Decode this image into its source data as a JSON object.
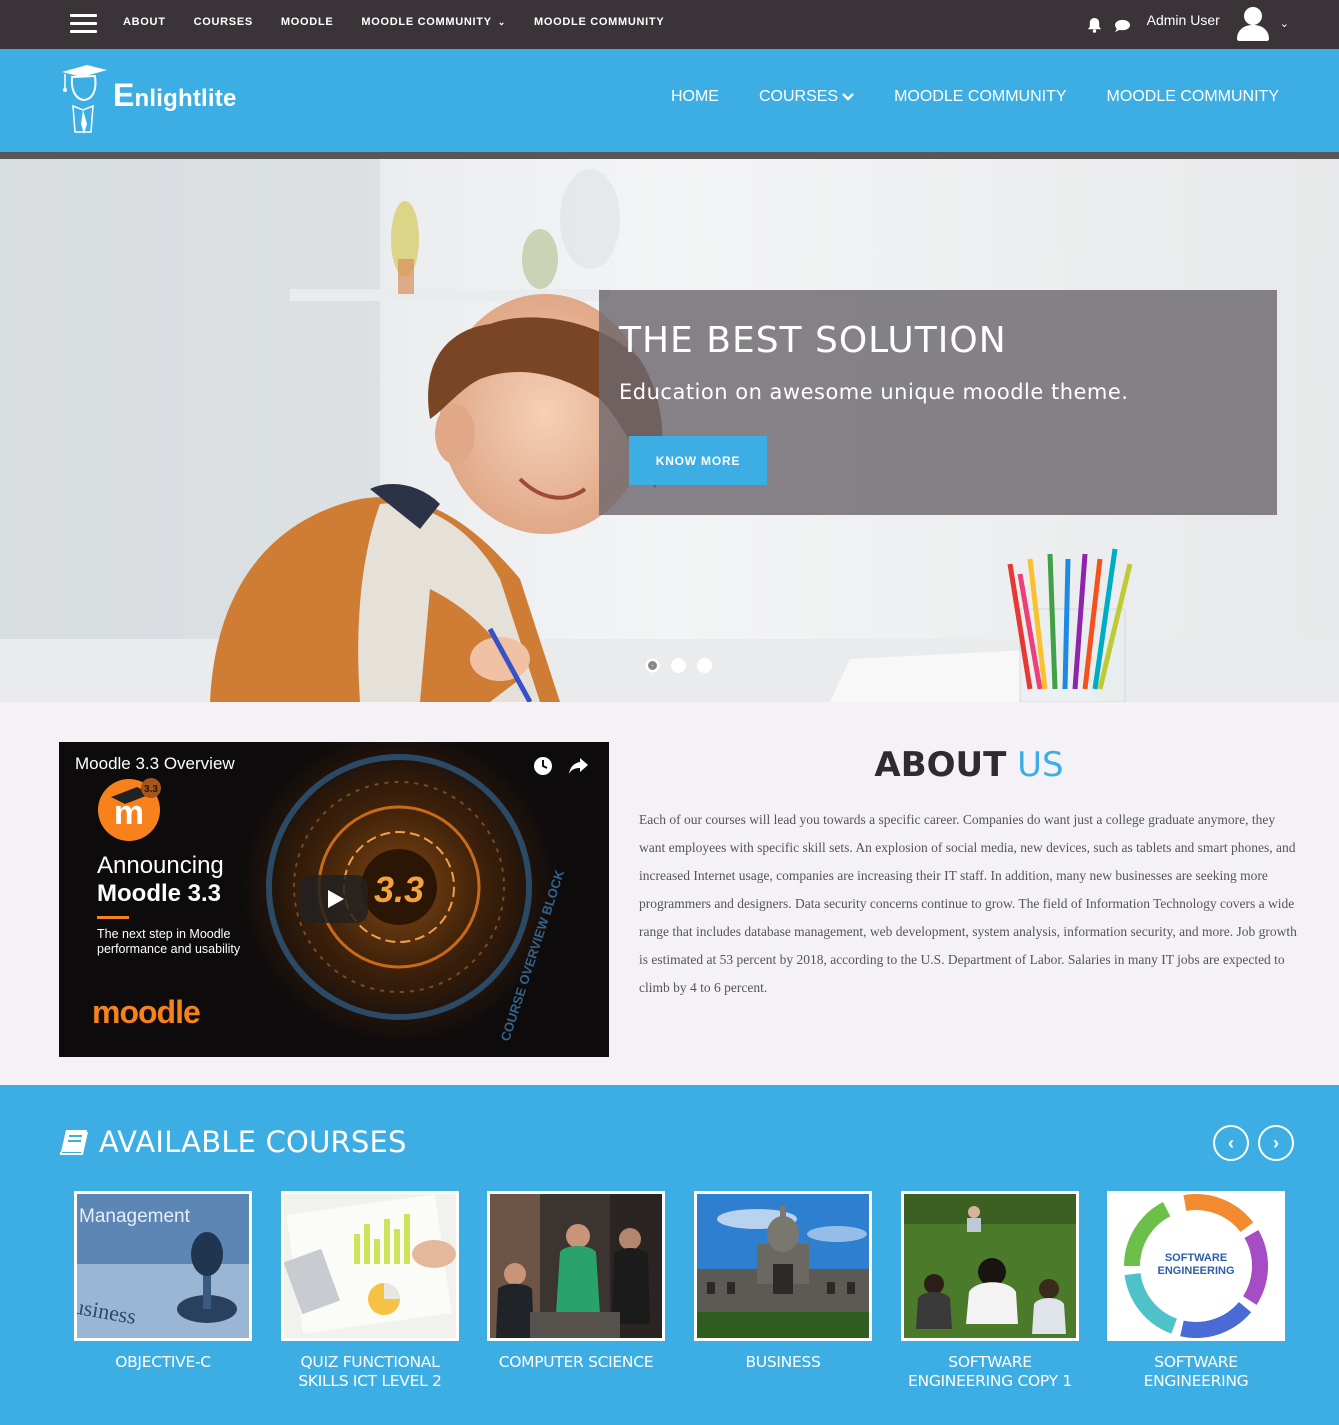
{
  "topbar": {
    "nav": [
      "ABOUT",
      "COURSES",
      "MOODLE",
      "MOODLE COMMUNITY",
      "MOODLE COMMUNITY"
    ],
    "user_name": "Admin User"
  },
  "header": {
    "logo_initial": "E",
    "logo_rest": "nlightlite",
    "nav": {
      "home": "HOME",
      "courses": "COURSES",
      "community1": "MOODLE COMMUNITY",
      "community2": "MOODLE COMMUNITY"
    }
  },
  "hero": {
    "title": "THE BEST SOLUTION",
    "subtitle": "Education on awesome unique moodle theme.",
    "button": "KNOW MORE",
    "slides": 3,
    "active_slide": 1
  },
  "video": {
    "title": "Moodle 3.3 Overview",
    "announce_line1": "Announcing",
    "announce_line2": "Moodle 3.3",
    "announce_line3": "The next step in Moodle performance and usability",
    "badge": "3.3",
    "brand": "moodle",
    "dial_text": "3.3",
    "ring_text": "COURSE OVERVIEW BLOCK"
  },
  "about": {
    "title_bold": "ABOUT",
    "title_accent": "US",
    "text": "Each of our courses will lead you towards a specific career. Companies do want just a college graduate anymore, they want employees with specific skill sets. An explosion of social media, new devices, such as tablets and smart phones, and increased Internet usage, companies are increasing their IT staff. In addition, many new businesses are seeking more programmers and designers. Data security concerns continue to grow. The field of Information Technology covers a wide range that includes database management, web development, system analysis, information security, and more. Job growth is estimated at 53 percent by 2018, according to the U.S. Department of Labor. Salaries in many IT jobs are expected to climb by 4 to 6 percent."
  },
  "courses": {
    "title": "AVAILABLE COURSES",
    "items": [
      {
        "name": "OBJECTIVE-C",
        "thumb_text": "Management"
      },
      {
        "name": "QUIZ FUNCTIONAL SKILLS ICT LEVEL 2"
      },
      {
        "name": "COMPUTER SCIENCE"
      },
      {
        "name": "BUSINESS"
      },
      {
        "name": "SOFTWARE ENGINEERING COPY 1"
      },
      {
        "name": "SOFTWARE ENGINEERING",
        "thumb_text": "SOFTWARE ENGINEERING"
      }
    ]
  },
  "colors": {
    "accent": "#3daee3",
    "topbar": "#3a3439",
    "moodle_orange": "#f7821b"
  }
}
